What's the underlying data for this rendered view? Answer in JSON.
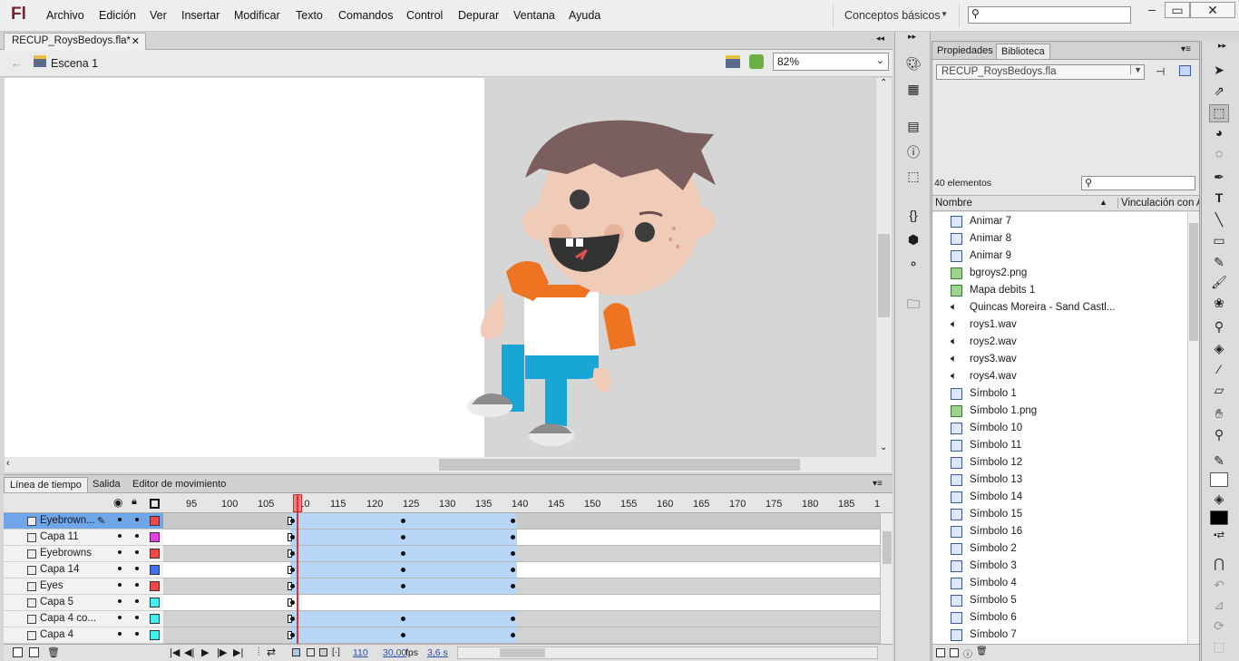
{
  "app": {
    "logo": "Fl"
  },
  "menu": [
    "Archivo",
    "Edición",
    "Ver",
    "Insertar",
    "Modificar",
    "Texto",
    "Comandos",
    "Control",
    "Depurar",
    "Ventana",
    "Ayuda"
  ],
  "workspace": {
    "label": "Conceptos básicos"
  },
  "document": {
    "tab_title": "RECUP_RoysBedoys.fla*",
    "scene": "Escena 1",
    "zoom": "82%"
  },
  "timeline": {
    "tabs": [
      "Línea de tiempo",
      "Salida",
      "Editor de movimiento"
    ],
    "frame_numbers": [
      "95",
      "100",
      "105",
      "110",
      "115",
      "120",
      "125",
      "130",
      "135",
      "140",
      "145",
      "150",
      "155",
      "160",
      "165",
      "170",
      "175",
      "180",
      "185",
      "1"
    ],
    "layers": [
      {
        "name": "Eyebrown...",
        "color": "#f04848",
        "selected": true,
        "span": [
          140,
          390
        ],
        "keys": [
          140,
          262,
          383
        ]
      },
      {
        "name": "Capa 11",
        "color": "#e040e0",
        "selected": false,
        "span": [
          140,
          390
        ],
        "keys": [
          140,
          262,
          383
        ]
      },
      {
        "name": "Eyebrowns",
        "color": "#f04848",
        "selected": false,
        "span": [
          140,
          390
        ],
        "keys": [
          140,
          262,
          383
        ]
      },
      {
        "name": "Capa 14",
        "color": "#4070f0",
        "selected": false,
        "span": [
          140,
          390
        ],
        "keys": [
          140,
          262,
          383
        ]
      },
      {
        "name": "Eyes",
        "color": "#f04848",
        "selected": false,
        "span": [
          140,
          390
        ],
        "keys": [
          140,
          262,
          383
        ]
      },
      {
        "name": "Capa 5",
        "color": "#40f0f0",
        "selected": false,
        "span": null,
        "keys": [
          140
        ]
      },
      {
        "name": "Capa 4 co...",
        "color": "#40f0f0",
        "selected": false,
        "span": [
          140,
          390
        ],
        "keys": [
          140,
          262,
          383
        ]
      },
      {
        "name": "Capa 4",
        "color": "#40f0f0",
        "selected": false,
        "span": [
          140,
          390
        ],
        "keys": [
          140,
          262,
          383
        ]
      }
    ],
    "status": {
      "frame": "110",
      "fps": "30,00",
      "fps_unit": "fps",
      "time": "3,6 s"
    }
  },
  "library": {
    "tabs": [
      "Propiedades",
      "Biblioteca"
    ],
    "document": "RECUP_RoysBedoys.fla",
    "count": "40 elementos",
    "col_name": "Nombre",
    "col_link": "Vinculación con A",
    "items": [
      {
        "name": "Animar 7",
        "type": "sym"
      },
      {
        "name": "Animar 8",
        "type": "sym"
      },
      {
        "name": "Animar 9",
        "type": "sym"
      },
      {
        "name": "bgroys2.png",
        "type": "png"
      },
      {
        "name": "Mapa debits 1",
        "type": "png"
      },
      {
        "name": "Quincas Moreira - Sand Castl...",
        "type": "snd"
      },
      {
        "name": "roys1.wav",
        "type": "snd"
      },
      {
        "name": "roys2.wav",
        "type": "snd"
      },
      {
        "name": "roys3.wav",
        "type": "snd"
      },
      {
        "name": "roys4.wav",
        "type": "snd"
      },
      {
        "name": "Símbolo 1",
        "type": "sym"
      },
      {
        "name": "Símbolo 1.png",
        "type": "png"
      },
      {
        "name": "Símbolo 10",
        "type": "sym"
      },
      {
        "name": "Símbolo 11",
        "type": "sym"
      },
      {
        "name": "Símbolo 12",
        "type": "sym"
      },
      {
        "name": "Símbolo 13",
        "type": "sym"
      },
      {
        "name": "Símbolo 14",
        "type": "sym"
      },
      {
        "name": "Símbolo 15",
        "type": "sym"
      },
      {
        "name": "Símbolo 16",
        "type": "sym"
      },
      {
        "name": "Símbolo 2",
        "type": "sym"
      },
      {
        "name": "Símbolo 3",
        "type": "sym"
      },
      {
        "name": "Símbolo 4",
        "type": "sym"
      },
      {
        "name": "Símbolo 5",
        "type": "sym"
      },
      {
        "name": "Símbolo 6",
        "type": "sym"
      },
      {
        "name": "Símbolo 7",
        "type": "sym"
      }
    ]
  },
  "colors": {
    "accent": "#6fa6e8",
    "span": "#b8d6f8",
    "playhead": "#d33333"
  }
}
